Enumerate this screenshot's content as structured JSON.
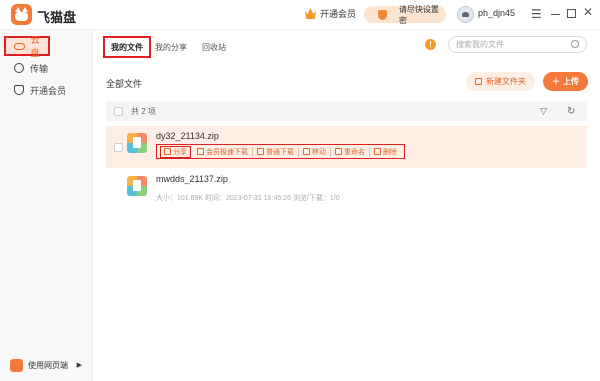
{
  "app": {
    "name": "飞猫盘"
  },
  "titlebar": {
    "vip_label": "开通会员",
    "promo_label": "请尽快设置密",
    "username": "ph_djn45"
  },
  "sidebar": {
    "items": [
      {
        "label": "云盘",
        "icon": "cloud-icon",
        "active": true
      },
      {
        "label": "传输",
        "icon": "transfer-icon",
        "active": false
      },
      {
        "label": "开通会员",
        "icon": "vip-shield-icon",
        "active": false
      }
    ],
    "web_label": "使用网页端"
  },
  "tabs": [
    {
      "label": "我的文件",
      "active": true
    },
    {
      "label": "我的分享",
      "active": false
    },
    {
      "label": "回收站",
      "active": false
    }
  ],
  "search": {
    "placeholder": "搜索我的文件"
  },
  "main": {
    "section_title": "全部文件",
    "new_folder_label": "新建文件夹",
    "upload_label": "上传",
    "count_label": "共 2 项"
  },
  "files": [
    {
      "name": "dy32_21134.zip",
      "highlighted": true,
      "actions": [
        "分享",
        "会员极速下载",
        "普通下载",
        "移动",
        "重命名",
        "删除"
      ]
    },
    {
      "name": "mwdds_21137.zip",
      "meta": "大小：101.69K  时间：2023-07-31 16:45:26  浏览/下载：1/0"
    }
  ],
  "colors": {
    "accent": "#f37a3a",
    "highlight": "#e02020"
  }
}
